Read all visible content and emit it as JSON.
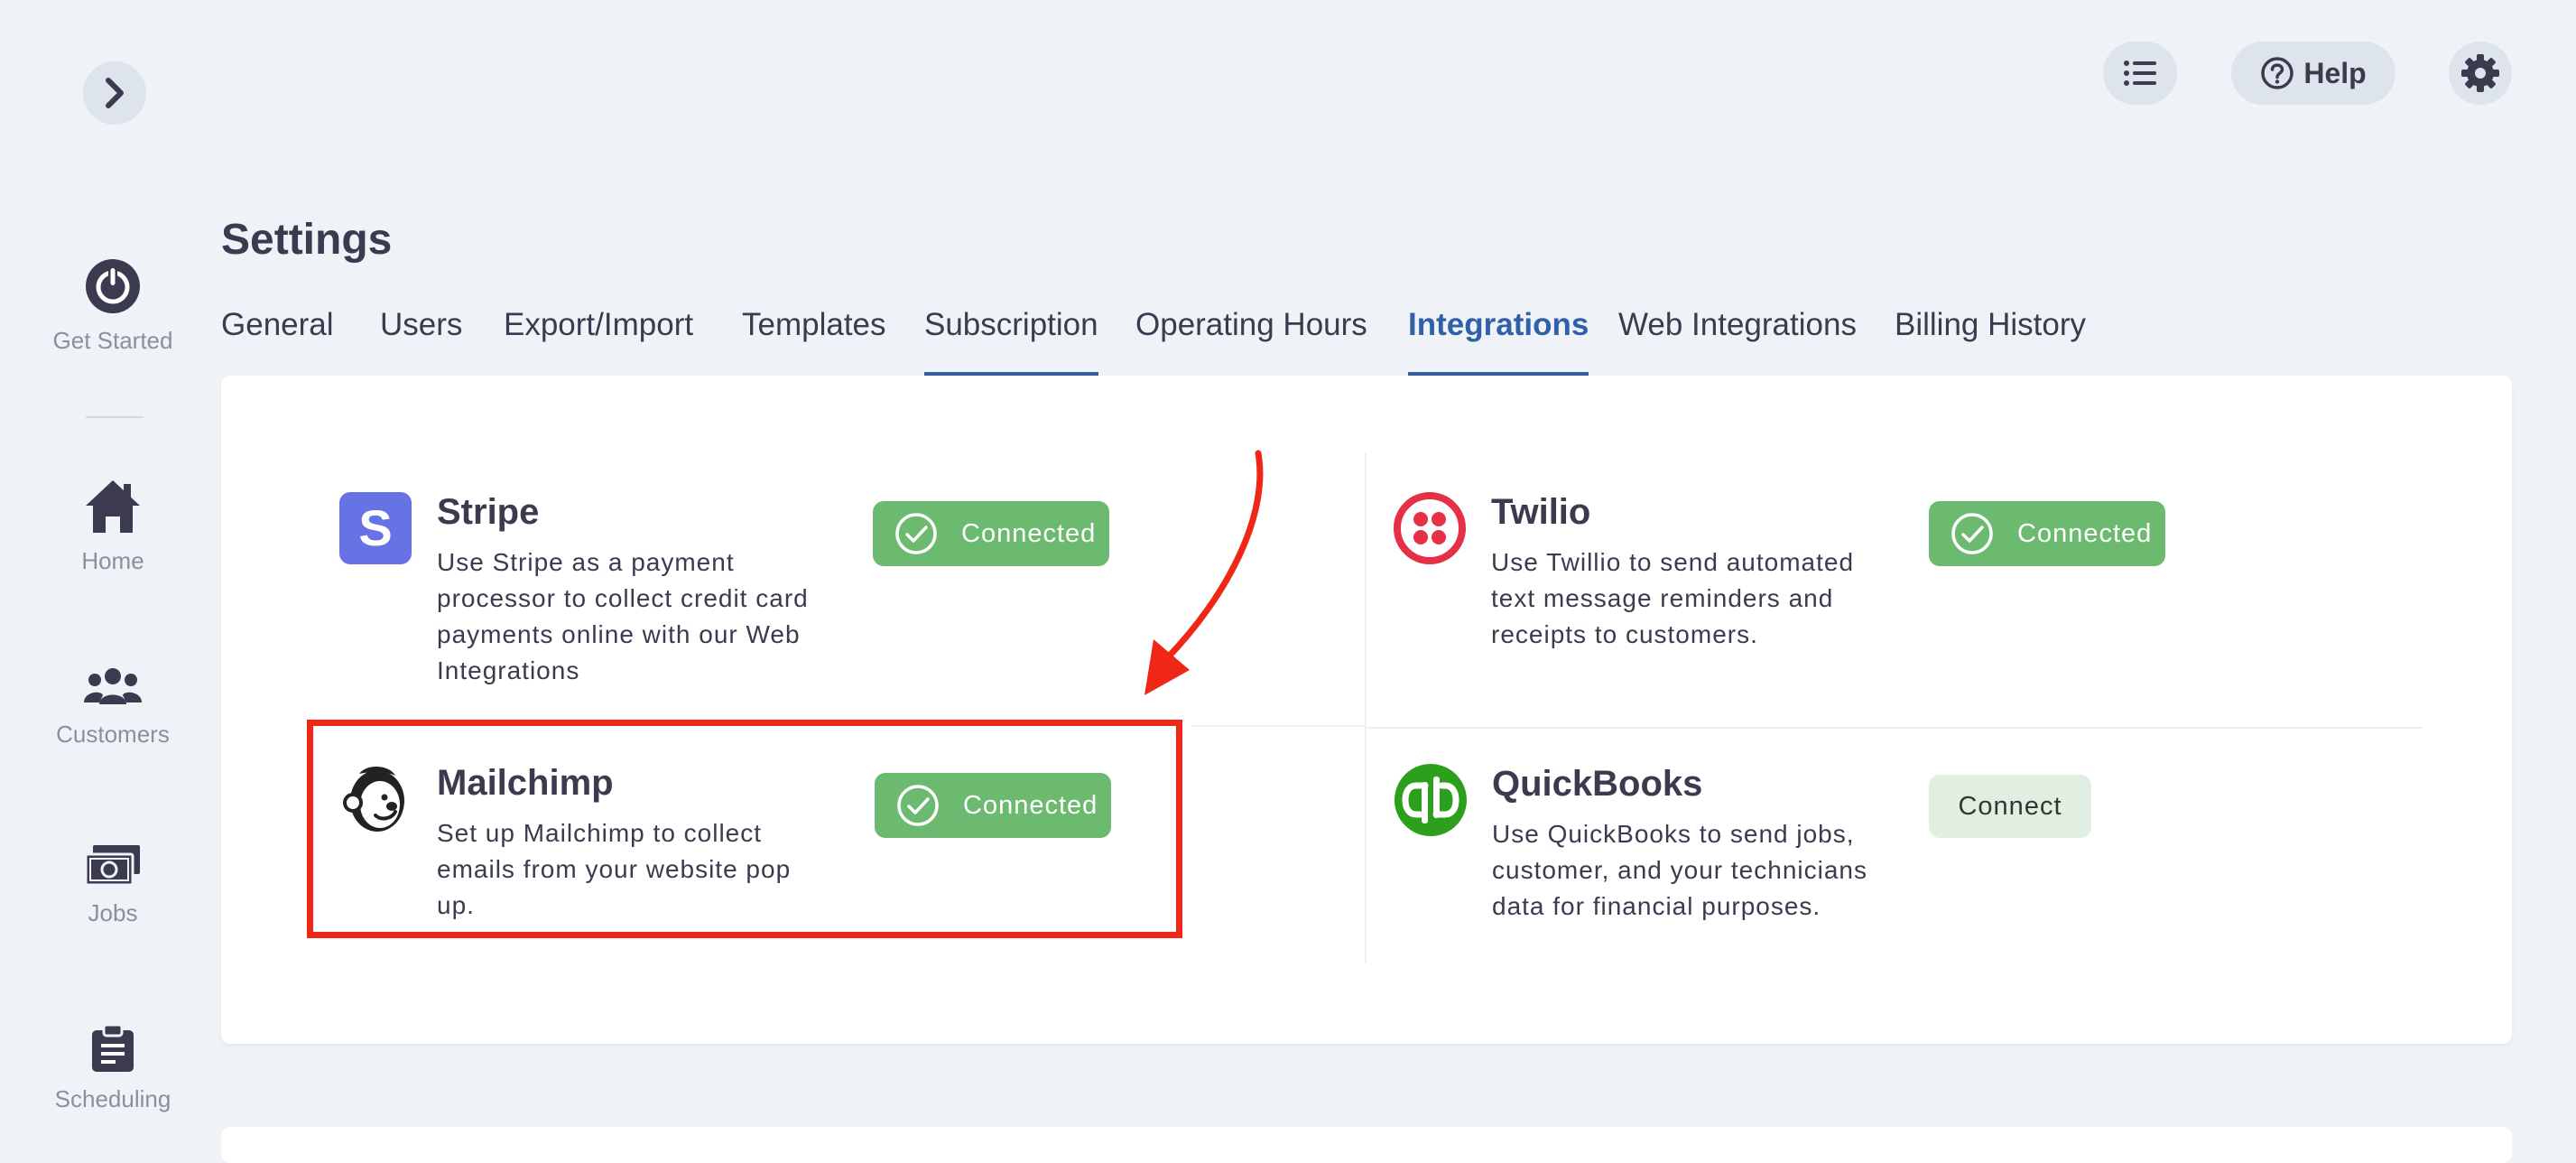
{
  "sidebar": {
    "items": [
      {
        "label": "Get Started",
        "icon": "power-icon"
      },
      {
        "label": "Home",
        "icon": "home-icon"
      },
      {
        "label": "Customers",
        "icon": "users-icon"
      },
      {
        "label": "Jobs",
        "icon": "money-icon"
      },
      {
        "label": "Scheduling",
        "icon": "clipboard-icon"
      }
    ]
  },
  "header": {
    "help_label": "Help"
  },
  "page": {
    "title": "Settings"
  },
  "tabs": [
    {
      "label": "General"
    },
    {
      "label": "Users"
    },
    {
      "label": "Export/Import"
    },
    {
      "label": "Templates"
    },
    {
      "label": "Subscription"
    },
    {
      "label": "Operating Hours"
    },
    {
      "label": "Integrations",
      "active": true
    },
    {
      "label": "Web Integrations"
    },
    {
      "label": "Billing History"
    }
  ],
  "integrations": {
    "stripe": {
      "name": "Stripe",
      "logo_letter": "S",
      "description": "Use Stripe as a payment processor to collect credit card payments online with our Web Integrations",
      "status": "Connected"
    },
    "twilio": {
      "name": "Twilio",
      "description": "Use Twillio to send automated text message reminders and receipts to customers.",
      "status": "Connected"
    },
    "mailchimp": {
      "name": "Mailchimp",
      "description": "Set up Mailchimp to collect emails from your website pop up.",
      "status": "Connected"
    },
    "quickbooks": {
      "name": "QuickBooks",
      "description": "Use QuickBooks to send jobs, customer, and your technicians data for financial purposes.",
      "action": "Connect"
    }
  },
  "colors": {
    "background": "#eff3f8",
    "accent_blue": "#2f60a8",
    "connected_green": "#6cba6f",
    "annotation_red": "#f02716",
    "stripe_purple": "#6772e5",
    "twilio_red": "#e53048",
    "quickbooks_green": "#2ca01c"
  }
}
